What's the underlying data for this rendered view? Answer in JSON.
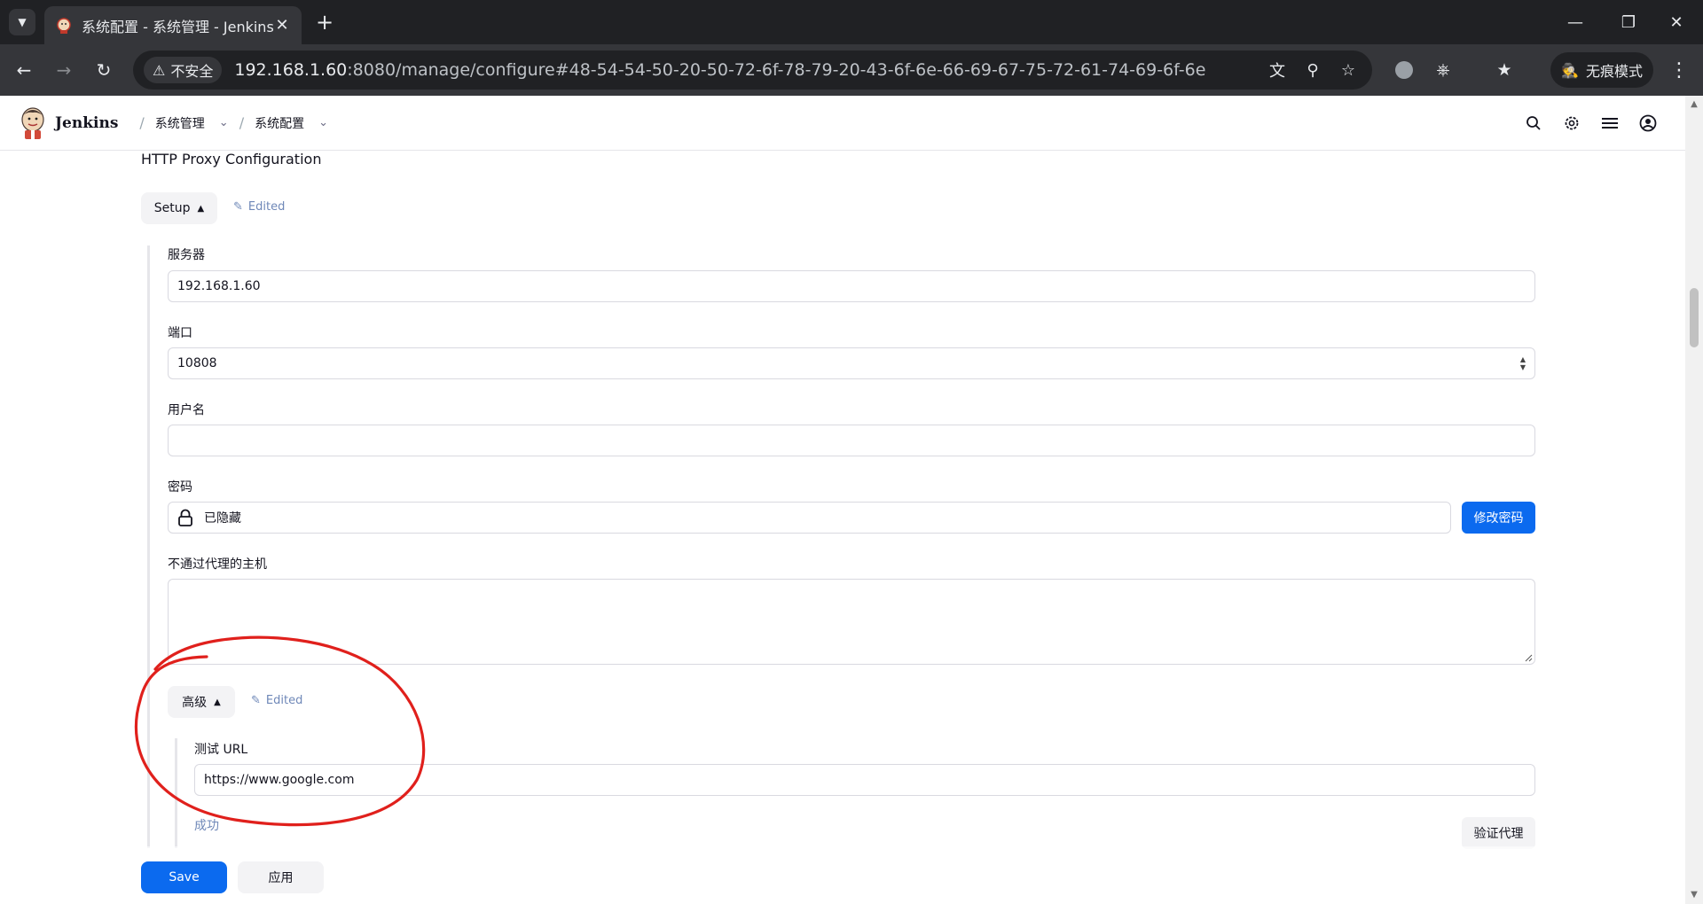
{
  "browser": {
    "tab_title": "系统配置 - 系统管理 - Jenkins",
    "tab_close": "✕",
    "new_tab": "+",
    "insecure_label": "不安全",
    "url_host": "192.168.1.60",
    "url_rest": ":8080/manage/configure#48-54-54-50-20-50-72-6f-78-79-20-43-6f-6e-66-69-67-75-72-61-74-69-6f-6e",
    "incognito_label": "无痕模式"
  },
  "header": {
    "brand": "Jenkins",
    "breadcrumbs": [
      {
        "label": "系统管理"
      },
      {
        "label": "系统配置"
      }
    ]
  },
  "section": {
    "title": "HTTP Proxy Configuration",
    "setup_label": "Setup",
    "edited_label": "Edited"
  },
  "form": {
    "server": {
      "label": "服务器",
      "value": "192.168.1.60"
    },
    "port": {
      "label": "端口",
      "value": "10808"
    },
    "username": {
      "label": "用户名",
      "value": ""
    },
    "password": {
      "label": "密码",
      "value": "已隐藏",
      "change_label": "修改密码"
    },
    "no_proxy": {
      "label": "不通过代理的主机",
      "value": ""
    }
  },
  "advanced": {
    "label": "高级",
    "edited_label": "Edited",
    "test_url": {
      "label": "测试 URL",
      "value": "https://www.google.com"
    },
    "result": "成功",
    "verify_label": "验证代理"
  },
  "actions": {
    "save_label": "Save",
    "apply_label": "应用"
  },
  "colors": {
    "primary": "#0b6aef",
    "annotation": "#e0201c",
    "edited_text": "#6f88b8"
  }
}
